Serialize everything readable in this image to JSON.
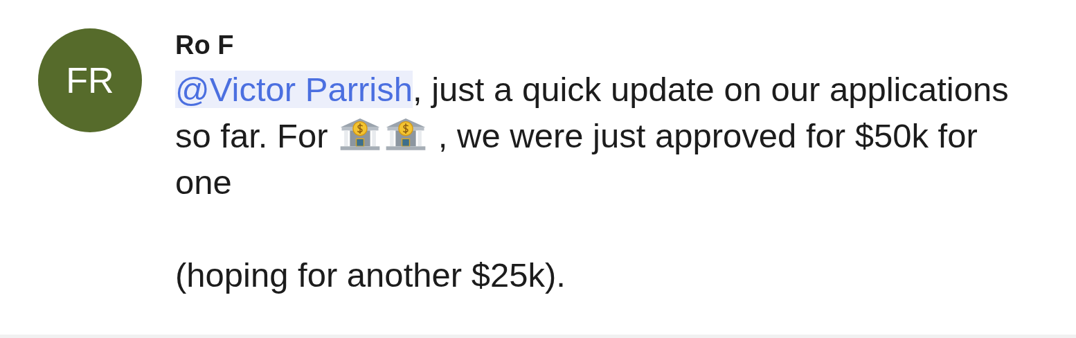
{
  "avatar": {
    "initials": "FR",
    "color": "#566b2b"
  },
  "message": {
    "author": "Ro F",
    "segments": [
      {
        "kind": "mention",
        "text": "@Victor Parrish"
      },
      {
        "kind": "text",
        "text": ", just a quick update on our applications so far.  For "
      },
      {
        "kind": "icon"
      },
      {
        "kind": "icon"
      },
      {
        "kind": "text",
        "text": " , we were just approved for $50k for one"
      }
    ],
    "note": "(hoping for another $25k)."
  }
}
